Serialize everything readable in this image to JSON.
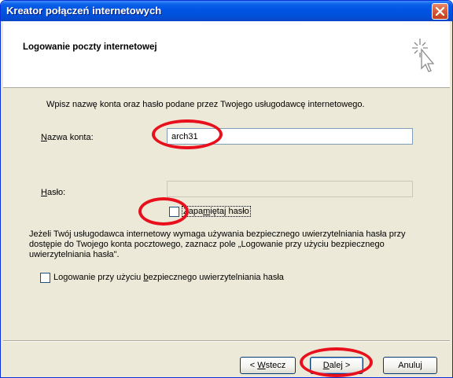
{
  "window": {
    "title": "Kreator połączeń internetowych"
  },
  "header": {
    "title": "Logowanie poczty internetowej"
  },
  "intro_text": "Wpisz nazwę konta oraz hasło podane przez Twojego usługodawcę internetowego.",
  "account": {
    "label_accel": "N",
    "label_rest": "azwa konta:",
    "value": "arch31"
  },
  "password": {
    "label_accel": "H",
    "label_rest": "asło:",
    "value": ""
  },
  "remember": {
    "label_pre": "Zapa",
    "label_accel": "m",
    "label_post": "iętaj hasło",
    "checked": false
  },
  "spa_paragraph": "Jeżeli Twój usługodawca internetowy wymaga używania bezpiecznego uwierzytelniania hasła przy dostępie do Twojego konta pocztowego, zaznacz pole „Logowanie przy użyciu bezpiecznego uwierzytelniania hasła\".",
  "spa_checkbox": {
    "label_pre": "Logowanie przy użyciu ",
    "label_accel": "b",
    "label_post": "ezpiecznego uwierzytelniania hasła",
    "checked": false
  },
  "buttons": {
    "back_pre": "< ",
    "back_accel": "W",
    "back_post": "stecz",
    "next_accel": "D",
    "next_post": "alej >",
    "cancel": "Anuluj"
  },
  "colors": {
    "titlebar": "#0054e3",
    "highlight": "#e8101c",
    "dialog_bg": "#ece9d8"
  }
}
